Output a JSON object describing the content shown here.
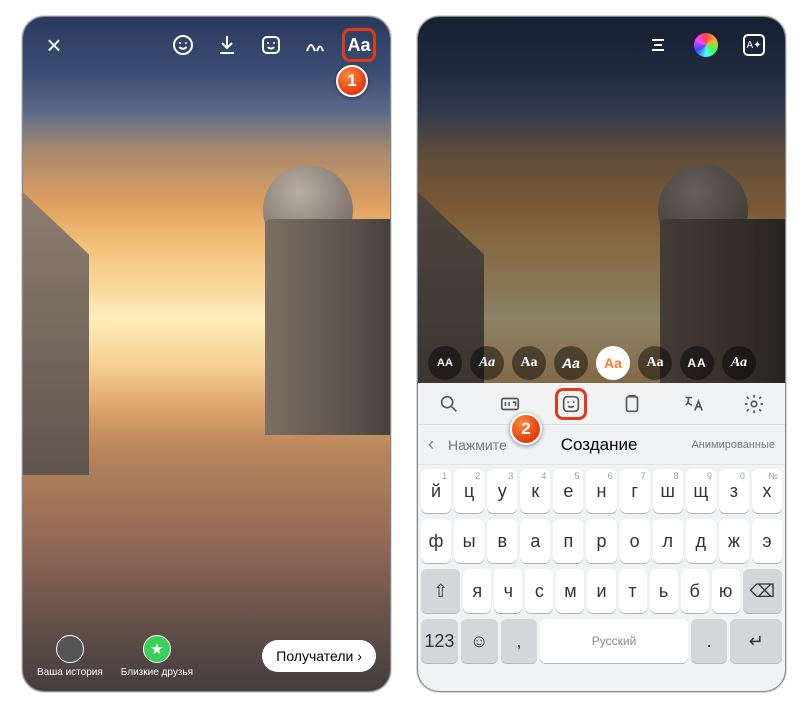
{
  "left": {
    "toolbar": {
      "close": "×",
      "text_label": "Aa"
    },
    "share": {
      "your_story": "Ваша история",
      "close_friends": "Близкие друзья",
      "recipients": "Получатели",
      "chevron": "›"
    },
    "annotation": "1"
  },
  "right": {
    "toolbar": {
      "effects_label": "A✦"
    },
    "font_chips": [
      "AA",
      "Aa",
      "Aa",
      "Aa",
      "Aa",
      "Aa",
      "AA",
      "Aa"
    ],
    "suggest": {
      "hint": "Нажмите",
      "main": "Создание",
      "alt": "Анимированные"
    },
    "keyboard": {
      "row1": [
        {
          "c": "й",
          "n": "1"
        },
        {
          "c": "ц",
          "n": "2"
        },
        {
          "c": "у",
          "n": "3"
        },
        {
          "c": "к",
          "n": "4"
        },
        {
          "c": "е",
          "n": "5"
        },
        {
          "c": "н",
          "n": "6"
        },
        {
          "c": "г",
          "n": "7"
        },
        {
          "c": "ш",
          "n": "8"
        },
        {
          "c": "щ",
          "n": "9"
        },
        {
          "c": "з",
          "n": "0"
        },
        {
          "c": "х",
          "n": "№"
        }
      ],
      "row2": [
        {
          "c": "ф"
        },
        {
          "c": "ы"
        },
        {
          "c": "в"
        },
        {
          "c": "а"
        },
        {
          "c": "п"
        },
        {
          "c": "р"
        },
        {
          "c": "о"
        },
        {
          "c": "л"
        },
        {
          "c": "д"
        },
        {
          "c": "ж"
        },
        {
          "c": "э"
        }
      ],
      "row3": [
        {
          "c": "я"
        },
        {
          "c": "ч"
        },
        {
          "c": "с"
        },
        {
          "c": "м"
        },
        {
          "c": "и"
        },
        {
          "c": "т"
        },
        {
          "c": "ь"
        },
        {
          "c": "б"
        },
        {
          "c": "ю"
        }
      ],
      "numkey": "123",
      "space": "Русский",
      "enter": "↵"
    },
    "annotation": "2"
  }
}
